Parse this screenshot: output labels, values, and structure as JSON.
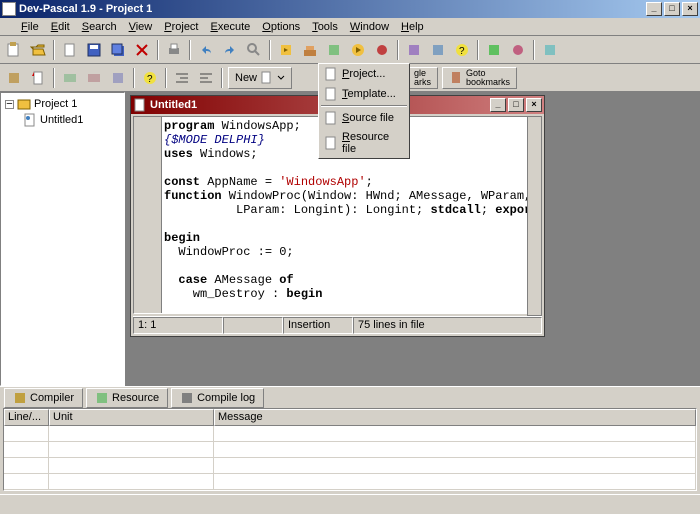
{
  "title": "Dev-Pascal 1.9 - Project 1",
  "menus": [
    "File",
    "Edit",
    "Search",
    "View",
    "Project",
    "Execute",
    "Options",
    "Tools",
    "Window",
    "Help"
  ],
  "toolbar2": {
    "new": "New"
  },
  "bookmarks": {
    "toggle": "Toggle\nbookmarks",
    "goto": "Goto\nbookmarks"
  },
  "tree": {
    "root": "Project 1",
    "child": "Untitled1"
  },
  "editor": {
    "title": "Untitled1",
    "code_lines": [
      {
        "t": "program",
        "k": "kw"
      },
      {
        "t": " WindowsApp;",
        "k": ""
      },
      {
        "t": "{$MODE DELPHI}",
        "k": "cm",
        "nl": 1
      },
      {
        "t": "uses",
        "k": "kw",
        "nl": 1
      },
      {
        "t": " Windows;",
        "k": ""
      },
      {
        "t": "",
        "k": "",
        "nl": 1
      },
      {
        "t": "const",
        "k": "kw",
        "nl": 1
      },
      {
        "t": " AppName = ",
        "k": ""
      },
      {
        "t": "'WindowsApp'",
        "k": "st"
      },
      {
        "t": ";",
        "k": ""
      },
      {
        "t": "function",
        "k": "kw",
        "nl": 1
      },
      {
        "t": " WindowProc(Window: HWnd; AMessage, WParam,",
        "k": ""
      },
      {
        "t": "          LParam: Longint): Longint; ",
        "k": "",
        "nl": 1
      },
      {
        "t": "stdcall",
        "k": "kw"
      },
      {
        "t": "; ",
        "k": ""
      },
      {
        "t": "export",
        "k": "kw"
      },
      {
        "t": ";",
        "k": ""
      },
      {
        "t": "",
        "k": "",
        "nl": 1
      },
      {
        "t": "begin",
        "k": "kw",
        "nl": 1
      },
      {
        "t": "  WindowProc := 0;",
        "k": "",
        "nl": 1
      },
      {
        "t": "",
        "k": "",
        "nl": 1
      },
      {
        "t": "  ",
        "k": "",
        "nl": 1
      },
      {
        "t": "case",
        "k": "kw"
      },
      {
        "t": " AMessage ",
        "k": ""
      },
      {
        "t": "of",
        "k": "kw"
      },
      {
        "t": "    wm_Destroy : ",
        "k": "",
        "nl": 1
      },
      {
        "t": "begin",
        "k": "kw"
      }
    ],
    "status": {
      "pos": "1: 1",
      "mode": "Insertion",
      "lines": "75 lines in file"
    }
  },
  "dropdown": {
    "items": [
      "Project...",
      "Template...",
      "Source file",
      "Resource file"
    ]
  },
  "bottom_tabs": [
    "Compiler",
    "Resource",
    "Compile log"
  ],
  "grid": {
    "cols": [
      "Line/...",
      "Unit",
      "Message"
    ]
  }
}
